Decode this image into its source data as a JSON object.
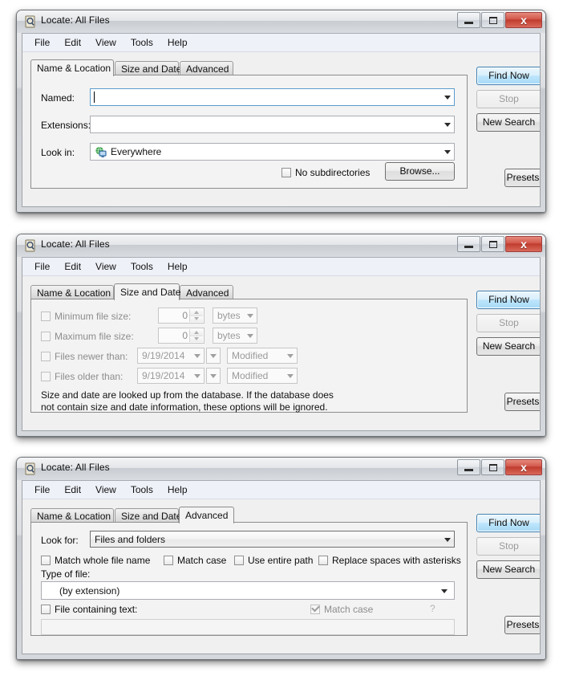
{
  "app": {
    "title": "Locate: All Files",
    "title_icon": "magnifier-document-icon",
    "menu": [
      "File",
      "Edit",
      "View",
      "Tools",
      "Help"
    ],
    "window_buttons": {
      "minimize": "minimize-icon",
      "maximize": "maximize-icon",
      "close": "x"
    },
    "action_buttons": {
      "find_now": "Find Now",
      "stop": "Stop",
      "new_search": "New Search",
      "presets": "Presets"
    },
    "tabs": [
      "Name & Location",
      "Size and Date",
      "Advanced"
    ]
  },
  "window1": {
    "active_tab": "Name & Location",
    "named": {
      "label": "Named:",
      "value": "",
      "focused": true
    },
    "extensions": {
      "label": "Extensions:",
      "value": ""
    },
    "look_in": {
      "label": "Look in:",
      "value": "Everywhere",
      "icon": "globe-computer-icon"
    },
    "no_subdirectories": {
      "label": "No subdirectories",
      "checked": false
    },
    "browse": "Browse..."
  },
  "window2": {
    "active_tab": "Size and Date",
    "min_size": {
      "label": "Minimum file size:",
      "checked": false,
      "value": "0",
      "unit": "bytes"
    },
    "max_size": {
      "label": "Maximum file size:",
      "checked": false,
      "value": "0",
      "unit": "bytes"
    },
    "newer_than": {
      "label": "Files newer than:",
      "checked": false,
      "date": "9/19/2014",
      "attribute": "Modified"
    },
    "older_than": {
      "label": "Files older than:",
      "checked": false,
      "date": "9/19/2014",
      "attribute": "Modified"
    },
    "info_text": "Size and date are looked up from the database. If the database does\nnot contain size and date information, these options will be ignored."
  },
  "window3": {
    "active_tab": "Advanced",
    "look_for": {
      "label": "Look for:",
      "value": "Files and folders"
    },
    "checkboxes": [
      {
        "label": "Match whole file name",
        "checked": false
      },
      {
        "label": "Match case",
        "checked": false
      },
      {
        "label": "Use entire path",
        "checked": false
      },
      {
        "label": "Replace spaces with asterisks",
        "checked": false
      }
    ],
    "type_of_file": {
      "label": "Type of file:",
      "value": "(by extension)"
    },
    "file_containing_text": {
      "label": "File containing text:",
      "checked": false,
      "value": ""
    },
    "match_case_dim": {
      "label": "Match case",
      "checked": true
    },
    "help_glyph": "?"
  },
  "colors": {
    "accent_default_button": "#a7d9f5",
    "close_button": "#bf3b2d",
    "menubar_bg": "#eef1f8",
    "client_bg": "#f0f0f0",
    "panel_bg": "#f3f3f3"
  }
}
